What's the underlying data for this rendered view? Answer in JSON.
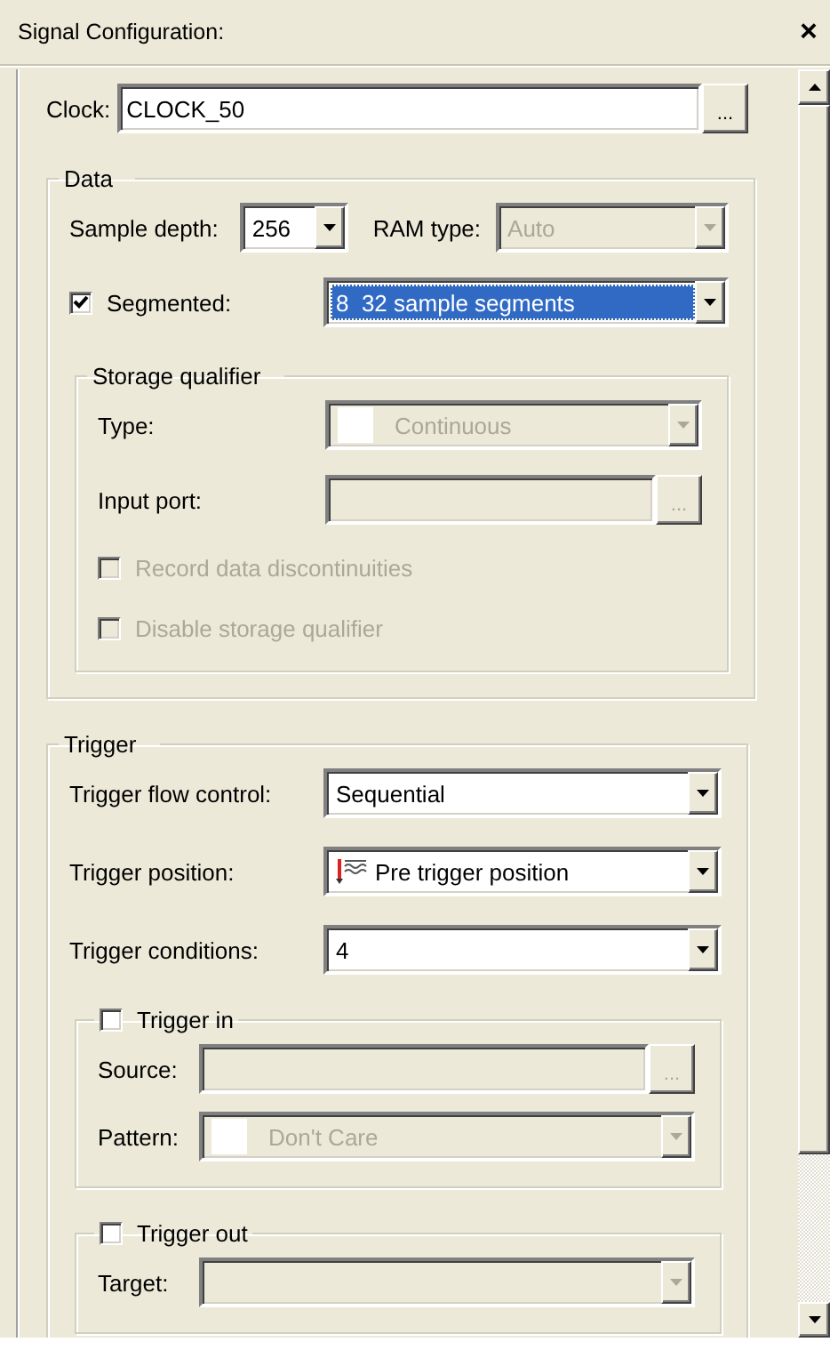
{
  "window": {
    "title": "Signal Configuration:",
    "close": "×"
  },
  "content": [
    {
      "kind": "row",
      "cells": [
        {
          "kind": "label",
          "text": "Clock:"
        },
        {
          "kind": "field",
          "value": "CLOCK_50",
          "disabled": false,
          "browse": "..."
        }
      ]
    },
    {
      "kind": "group",
      "title": "Data",
      "items": [
        {
          "kind": "row",
          "cells": [
            {
              "kind": "label",
              "text": "Sample depth:"
            },
            {
              "kind": "combo",
              "value": "256",
              "disabled": false,
              "selected": false
            },
            {
              "kind": "label",
              "text": "RAM type:"
            },
            {
              "kind": "combo",
              "value": "Auto",
              "disabled": true,
              "selected": false
            }
          ]
        },
        {
          "kind": "row",
          "cells": [
            {
              "kind": "check",
              "label": "Segmented:",
              "checked": true,
              "disabled": false
            },
            {
              "kind": "combo",
              "value": "8  32 sample segments",
              "disabled": false,
              "selected": true
            }
          ]
        },
        {
          "kind": "group",
          "title": "Storage qualifier",
          "items": [
            {
              "kind": "row",
              "cells": [
                {
                  "kind": "label",
                  "text": "Type:"
                },
                {
                  "kind": "swatch-combo",
                  "value": "Continuous",
                  "disabled": true,
                  "selected": false
                }
              ]
            },
            {
              "kind": "row",
              "cells": [
                {
                  "kind": "label",
                  "text": "Input port:"
                },
                {
                  "kind": "field",
                  "disabled": true,
                  "browse": "..."
                }
              ]
            },
            {
              "kind": "row",
              "cells": [
                {
                  "kind": "check",
                  "label": "Record data discontinuities",
                  "checked": false,
                  "disabled": true
                }
              ]
            },
            {
              "kind": "row",
              "cells": [
                {
                  "kind": "check",
                  "label": "Disable storage qualifier",
                  "checked": false,
                  "disabled": true
                }
              ]
            }
          ]
        }
      ]
    },
    {
      "kind": "group",
      "title": "Trigger",
      "items": [
        {
          "kind": "row",
          "cells": [
            {
              "kind": "label",
              "text": "Trigger flow control:"
            },
            {
              "kind": "combo",
              "value": "Sequential",
              "disabled": false,
              "selected": false
            }
          ]
        },
        {
          "kind": "row",
          "cells": [
            {
              "kind": "label",
              "text": "Trigger position:"
            },
            {
              "kind": "flag-combo",
              "value": "Pre trigger position",
              "disabled": false,
              "selected": false
            }
          ]
        },
        {
          "kind": "row",
          "cells": [
            {
              "kind": "label",
              "text": "Trigger conditions:"
            },
            {
              "kind": "combo",
              "value": "4",
              "disabled": false,
              "selected": false
            }
          ]
        },
        {
          "kind": "group",
          "title": "Trigger in",
          "check": {
            "checked": false
          },
          "items": [
            {
              "kind": "row",
              "cells": [
                {
                  "kind": "label",
                  "text": "Source:"
                },
                {
                  "kind": "field",
                  "disabled": true,
                  "browse": "..."
                }
              ]
            },
            {
              "kind": "row",
              "cells": [
                {
                  "kind": "label",
                  "text": "Pattern:"
                },
                {
                  "kind": "swatch-combo",
                  "value": "Don't Care",
                  "disabled": true,
                  "selected": false
                }
              ]
            }
          ]
        },
        {
          "kind": "group",
          "title": "Trigger out",
          "check": {
            "checked": false
          },
          "items": [
            {
              "kind": "row",
              "cells": [
                {
                  "kind": "label",
                  "text": "Target:"
                },
                {
                  "kind": "combo",
                  "disabled": true,
                  "selected": false
                }
              ]
            }
          ]
        }
      ]
    }
  ]
}
